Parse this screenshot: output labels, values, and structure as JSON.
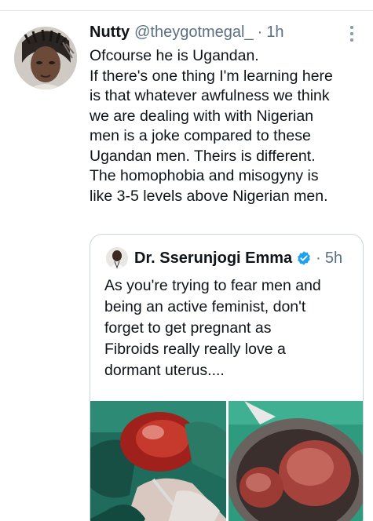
{
  "tweet": {
    "author_name": "Nutty",
    "author_handle": "@theygotmegal_",
    "separator": "·",
    "time": "1h",
    "text_lines": [
      "Ofcourse he is Ugandan.",
      "If there's one thing I'm learning here",
      "is that whatever awfulness we think",
      "we are dealing with with Nigerian",
      "men is a joke compared to these",
      "Ugandan men. Theirs is different.",
      "The homophobia and misogyny is",
      "like 3-5 levels above Nigerian men."
    ]
  },
  "quoted": {
    "author_name": "Dr. Sserunjogi Emma",
    "separator": "·",
    "time": "5h",
    "verified": true,
    "text_lines": [
      "As you're trying to fear men and",
      "being an active feminist, don't",
      "forget to get pregnant as",
      "Fibroids really really love a",
      "dormant uterus...."
    ]
  },
  "icons": {
    "more": "more-vertical-icon",
    "verified": "verified-badge-icon"
  },
  "colors": {
    "text": "#0f1419",
    "secondary": "#5b7083",
    "border": "#ccd6dd",
    "verified": "#1da1f2"
  }
}
